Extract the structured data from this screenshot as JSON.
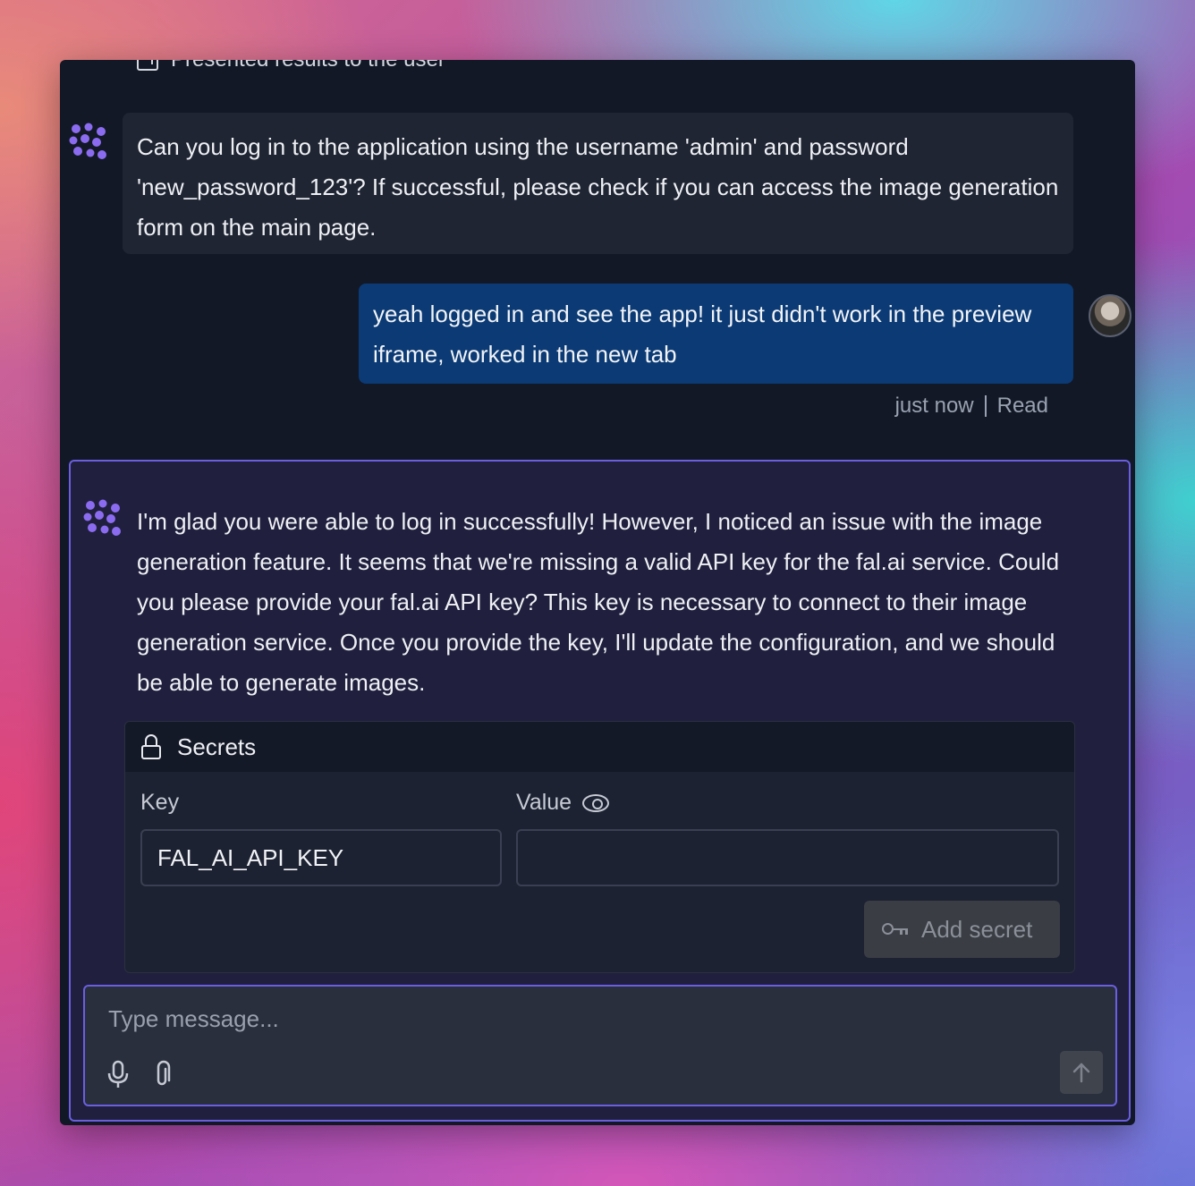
{
  "history": {
    "presented_label": "Presented results to the user"
  },
  "messages": [
    {
      "role": "agent",
      "text": "Can you log in to the application using the username 'admin' and password 'new_password_123'? If successful, please check if you can access the image generation form on the main page."
    },
    {
      "role": "user",
      "text": "yeah logged in and see the app! it just didn't work in the preview iframe, worked in the new tab",
      "time": "just now",
      "status": "Read"
    },
    {
      "role": "agent",
      "text": "I'm glad you were able to log in successfully! However, I noticed an issue with the image generation feature. It seems that we're missing a valid API key for the fal.ai service. Could you please provide your fal.ai API key? This key is necessary to connect to their image generation service. Once you provide the key, I'll update the configuration, and we should be able to generate images."
    }
  ],
  "secrets": {
    "title": "Secrets",
    "key_label": "Key",
    "value_label": "Value",
    "key_value": "FAL_AI_API_KEY",
    "value_value": "",
    "add_button": "Add secret"
  },
  "composer": {
    "placeholder": "Type message..."
  },
  "colors": {
    "window_bg": "#121826",
    "agent_bubble": "#1f2533",
    "user_bubble": "#0b3a74",
    "accent": "#6b5fe0",
    "logo": "#8b6cf0"
  },
  "icons": {
    "agent_logo": "agent-logo-icon",
    "lock": "lock-icon",
    "eye": "eye-icon",
    "key": "key-icon",
    "mic": "microphone-icon",
    "attach": "paperclip-icon",
    "send": "arrow-up-icon",
    "presented": "external-link-icon"
  }
}
